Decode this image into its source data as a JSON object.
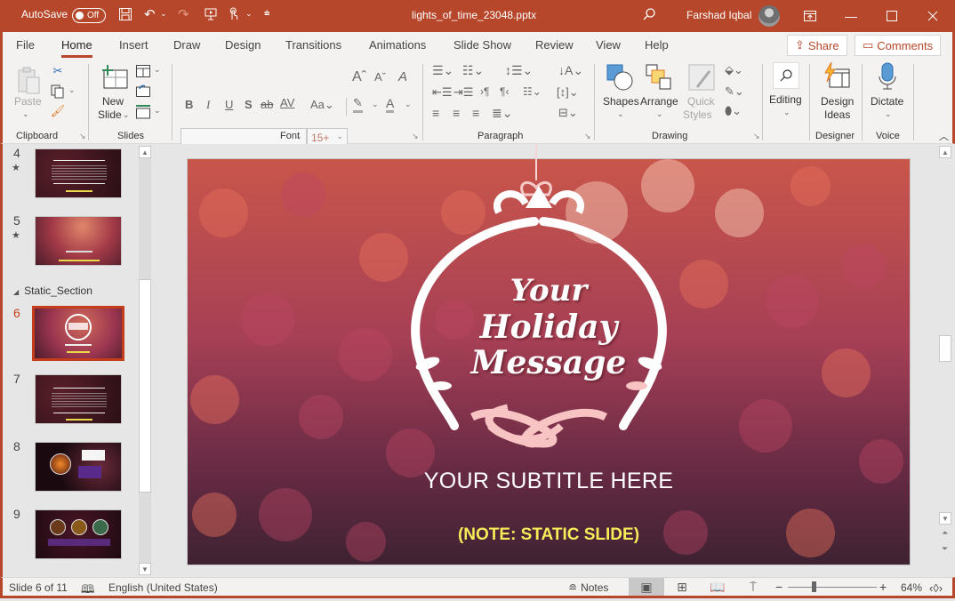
{
  "titlebar": {
    "autosave_label": "AutoSave",
    "autosave_state": "Off",
    "document_title": "lights_of_time_23048.pptx",
    "user_name": "Farshad Iqbal",
    "qat_icons": [
      "save-icon",
      "undo-icon",
      "redo-icon",
      "present-from-beginning-icon",
      "touch-mode-icon",
      "customize-qat-icon"
    ],
    "window_buttons": [
      "ribbon-display-options",
      "minimize",
      "maximize",
      "close"
    ]
  },
  "tabs": [
    "File",
    "Home",
    "Insert",
    "Draw",
    "Design",
    "Transitions",
    "Animations",
    "Slide Show",
    "Review",
    "View",
    "Help"
  ],
  "active_tab": "Home",
  "share_label": "Share",
  "comments_label": "Comments",
  "ribbon": {
    "clipboard": {
      "label": "Clipboard",
      "paste": "Paste"
    },
    "slides": {
      "label": "Slides",
      "new_slide_1": "New",
      "new_slide_2": "Slide"
    },
    "font": {
      "label": "Font",
      "font_name": "",
      "font_size": "15+"
    },
    "paragraph": {
      "label": "Paragraph"
    },
    "drawing": {
      "label": "Drawing",
      "shapes": "Shapes",
      "arrange": "Arrange",
      "quick_styles_1": "Quick",
      "quick_styles_2": "Styles"
    },
    "editing": {
      "label": "Editing"
    },
    "designer": {
      "label": "Designer",
      "design_ideas_1": "Design",
      "design_ideas_2": "Ideas"
    },
    "voice": {
      "label": "Voice",
      "dictate": "Dictate"
    }
  },
  "thumbnails": {
    "section_name": "Static_Section",
    "slides": [
      {
        "number": "4",
        "animated": true
      },
      {
        "number": "5",
        "animated": true
      },
      {
        "number": "6",
        "animated": false,
        "selected": true
      },
      {
        "number": "7",
        "animated": false
      },
      {
        "number": "8",
        "animated": false
      },
      {
        "number": "9",
        "animated": false
      }
    ]
  },
  "slide": {
    "title_line1": "Your",
    "title_line2": "Holiday",
    "title_line3": "Message",
    "subtitle": "YOUR SUBTITLE HERE",
    "note": "(NOTE: STATIC SLIDE)",
    "accent_colors": {
      "note": "#f6ec5a",
      "background_top": "#c9564b",
      "background_bottom": "#3e2232"
    }
  },
  "statusbar": {
    "slide_indicator": "Slide 6 of 11",
    "language": "English (United States)",
    "notes_label": "Notes",
    "zoom_level": "64%",
    "zoom_fraction": 0.64
  },
  "colors": {
    "accent": "#b7472a",
    "selection": "#c43e1c"
  }
}
